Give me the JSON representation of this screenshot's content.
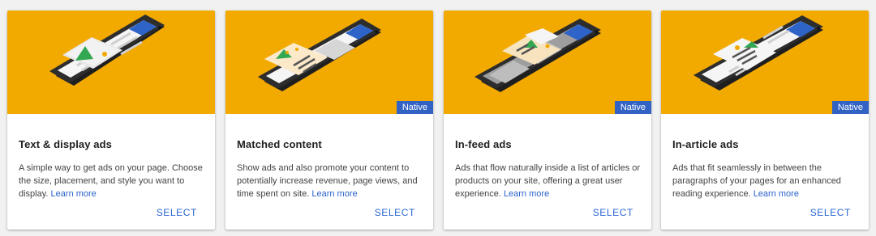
{
  "colors": {
    "hero_background": "#f2a900",
    "badge_background": "#3162c4",
    "link": "#2a62c9",
    "select": "#2a66d2"
  },
  "cards": [
    {
      "title": "Text & display ads",
      "description": "A simple way to get ads on your page. Choose the size, placement, and style you want to display.",
      "learn_more": "Learn more",
      "select": "SELECT",
      "badge": ""
    },
    {
      "title": "Matched content",
      "description": "Show ads and also promote your content to potentially increase revenue, page views, and time spent on site.",
      "learn_more": "Learn more",
      "select": "SELECT",
      "badge": "Native"
    },
    {
      "title": "In-feed ads",
      "description": "Ads that flow naturally inside a list of articles or products on your site, offering a great user experience.",
      "learn_more": "Learn more",
      "select": "SELECT",
      "badge": "Native"
    },
    {
      "title": "In-article ads",
      "description": "Ads that fit seamlessly in between the paragraphs of your pages for an enhanced reading experience.",
      "learn_more": "Learn more",
      "select": "SELECT",
      "badge": "Native"
    }
  ]
}
